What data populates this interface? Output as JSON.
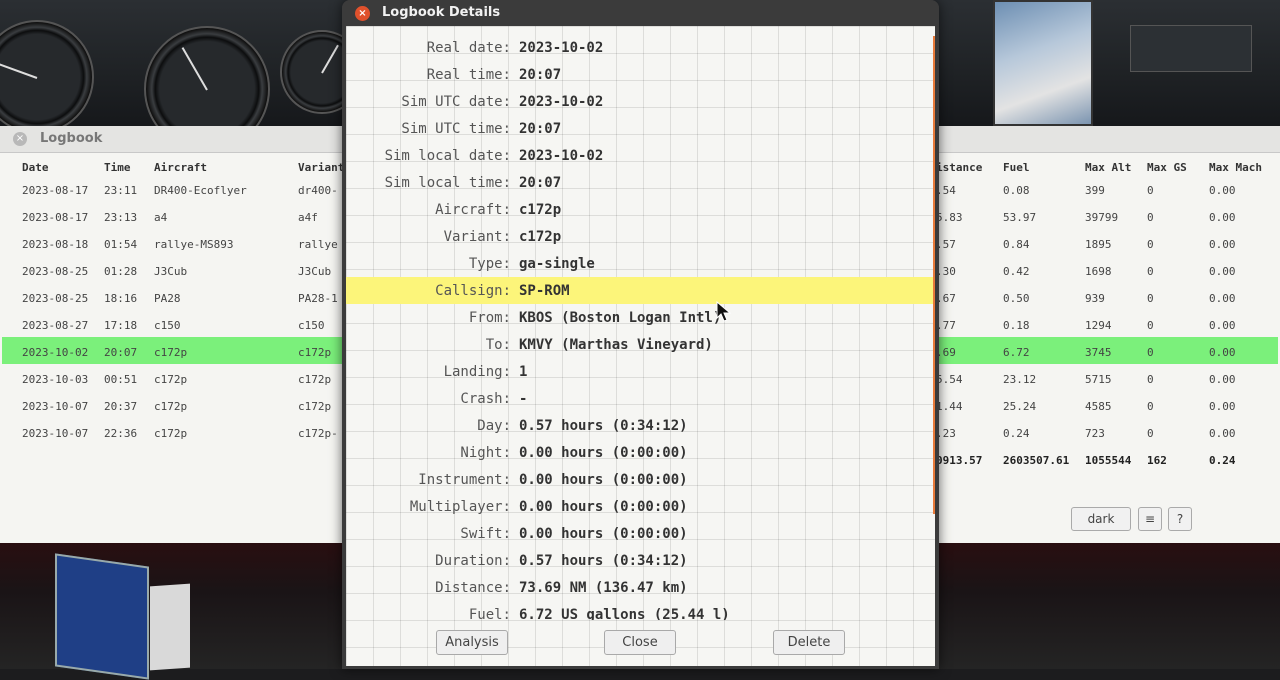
{
  "logbook": {
    "title": "Logbook",
    "columns_left": [
      "Date",
      "Time",
      "Aircraft",
      "Variant"
    ],
    "columns_right": [
      "istance",
      "Fuel",
      "Max Alt",
      "Max GS",
      "Max Mach"
    ],
    "rows": [
      {
        "date": "2023-08-17",
        "time": "23:11",
        "aircraft": "DR400-Ecoflyer",
        "variant": "dr400-",
        "distance": ".54",
        "fuel": "0.08",
        "max_alt": "399",
        "max_gs": "0",
        "max_mach": "0.00"
      },
      {
        "date": "2023-08-17",
        "time": "23:13",
        "aircraft": "a4",
        "variant": "a4f",
        "distance": "5.83",
        "fuel": "53.97",
        "max_alt": "39799",
        "max_gs": "0",
        "max_mach": "0.00"
      },
      {
        "date": "2023-08-18",
        "time": "01:54",
        "aircraft": "rallye-MS893",
        "variant": "rallye",
        "distance": ".57",
        "fuel": "0.84",
        "max_alt": "1895",
        "max_gs": "0",
        "max_mach": "0.00"
      },
      {
        "date": "2023-08-25",
        "time": "01:28",
        "aircraft": "J3Cub",
        "variant": "J3Cub",
        "distance": ".30",
        "fuel": "0.42",
        "max_alt": "1698",
        "max_gs": "0",
        "max_mach": "0.00"
      },
      {
        "date": "2023-08-25",
        "time": "18:16",
        "aircraft": "PA28",
        "variant": "PA28-1",
        "distance": ".67",
        "fuel": "0.50",
        "max_alt": "939",
        "max_gs": "0",
        "max_mach": "0.00"
      },
      {
        "date": "2023-08-27",
        "time": "17:18",
        "aircraft": "c150",
        "variant": "c150",
        "distance": ".77",
        "fuel": "0.18",
        "max_alt": "1294",
        "max_gs": "0",
        "max_mach": "0.00"
      },
      {
        "date": "2023-10-02",
        "time": "20:07",
        "aircraft": "c172p",
        "variant": "c172p",
        "distance": ".69",
        "fuel": "6.72",
        "max_alt": "3745",
        "max_gs": "0",
        "max_mach": "0.00"
      },
      {
        "date": "2023-10-03",
        "time": "00:51",
        "aircraft": "c172p",
        "variant": "c172p",
        "distance": "5.54",
        "fuel": "23.12",
        "max_alt": "5715",
        "max_gs": "0",
        "max_mach": "0.00"
      },
      {
        "date": "2023-10-07",
        "time": "20:37",
        "aircraft": "c172p",
        "variant": "c172p",
        "distance": "1.44",
        "fuel": "25.24",
        "max_alt": "4585",
        "max_gs": "0",
        "max_mach": "0.00"
      },
      {
        "date": "2023-10-07",
        "time": "22:36",
        "aircraft": "c172p",
        "variant": "c172p-",
        "distance": ".23",
        "fuel": "0.24",
        "max_alt": "723",
        "max_gs": "0",
        "max_mach": "0.00"
      }
    ],
    "selected_row_index": 6,
    "totals": {
      "distance": "0913.57",
      "fuel": "2603507.61",
      "max_alt": "1055544",
      "max_gs": "162",
      "max_mach": "0.24"
    },
    "buttons": {
      "dark": "dark",
      "menu": "≡",
      "help": "?"
    }
  },
  "details": {
    "title": "Logbook Details",
    "close_glyph": "×",
    "fields": [
      {
        "label": "Real date:",
        "value": "2023-10-02"
      },
      {
        "label": "Real time:",
        "value": "20:07"
      },
      {
        "label": "Sim UTC date:",
        "value": "2023-10-02"
      },
      {
        "label": "Sim UTC time:",
        "value": "20:07"
      },
      {
        "label": "Sim local date:",
        "value": "2023-10-02"
      },
      {
        "label": "Sim local time:",
        "value": "20:07"
      },
      {
        "label": "Aircraft:",
        "value": "c172p"
      },
      {
        "label": "Variant:",
        "value": "c172p"
      },
      {
        "label": "Type:",
        "value": "ga-single"
      },
      {
        "label": "Callsign:",
        "value": "SP-ROM"
      },
      {
        "label": "From:",
        "value": "KBOS (Boston Logan Intl)"
      },
      {
        "label": "To:",
        "value": "KMVY (Marthas Vineyard)"
      },
      {
        "label": "Landing:",
        "value": "1"
      },
      {
        "label": "Crash:",
        "value": "-"
      },
      {
        "label": "Day:",
        "value": "0.57 hours (0:34:12)"
      },
      {
        "label": "Night:",
        "value": "0.00 hours (0:00:00)"
      },
      {
        "label": "Instrument:",
        "value": "0.00 hours (0:00:00)"
      },
      {
        "label": "Multiplayer:",
        "value": "0.00 hours (0:00:00)"
      },
      {
        "label": "Swift:",
        "value": "0.00 hours (0:00:00)"
      },
      {
        "label": "Duration:",
        "value": "0.57 hours (0:34:12)"
      },
      {
        "label": "Distance:",
        "value": "73.69 NM (136.47 km)"
      },
      {
        "label": "Fuel:",
        "value": "6.72 US gallons (25.44 l)"
      }
    ],
    "highlighted_field_index": 9,
    "buttons": {
      "analysis": "Analysis",
      "close": "Close",
      "delete": "Delete"
    }
  },
  "colors": {
    "selected_row": "#7bf07b",
    "highlight_field": "#fcf57a",
    "close_button": "#e0512c",
    "scrollbar": "#e87a3a"
  }
}
